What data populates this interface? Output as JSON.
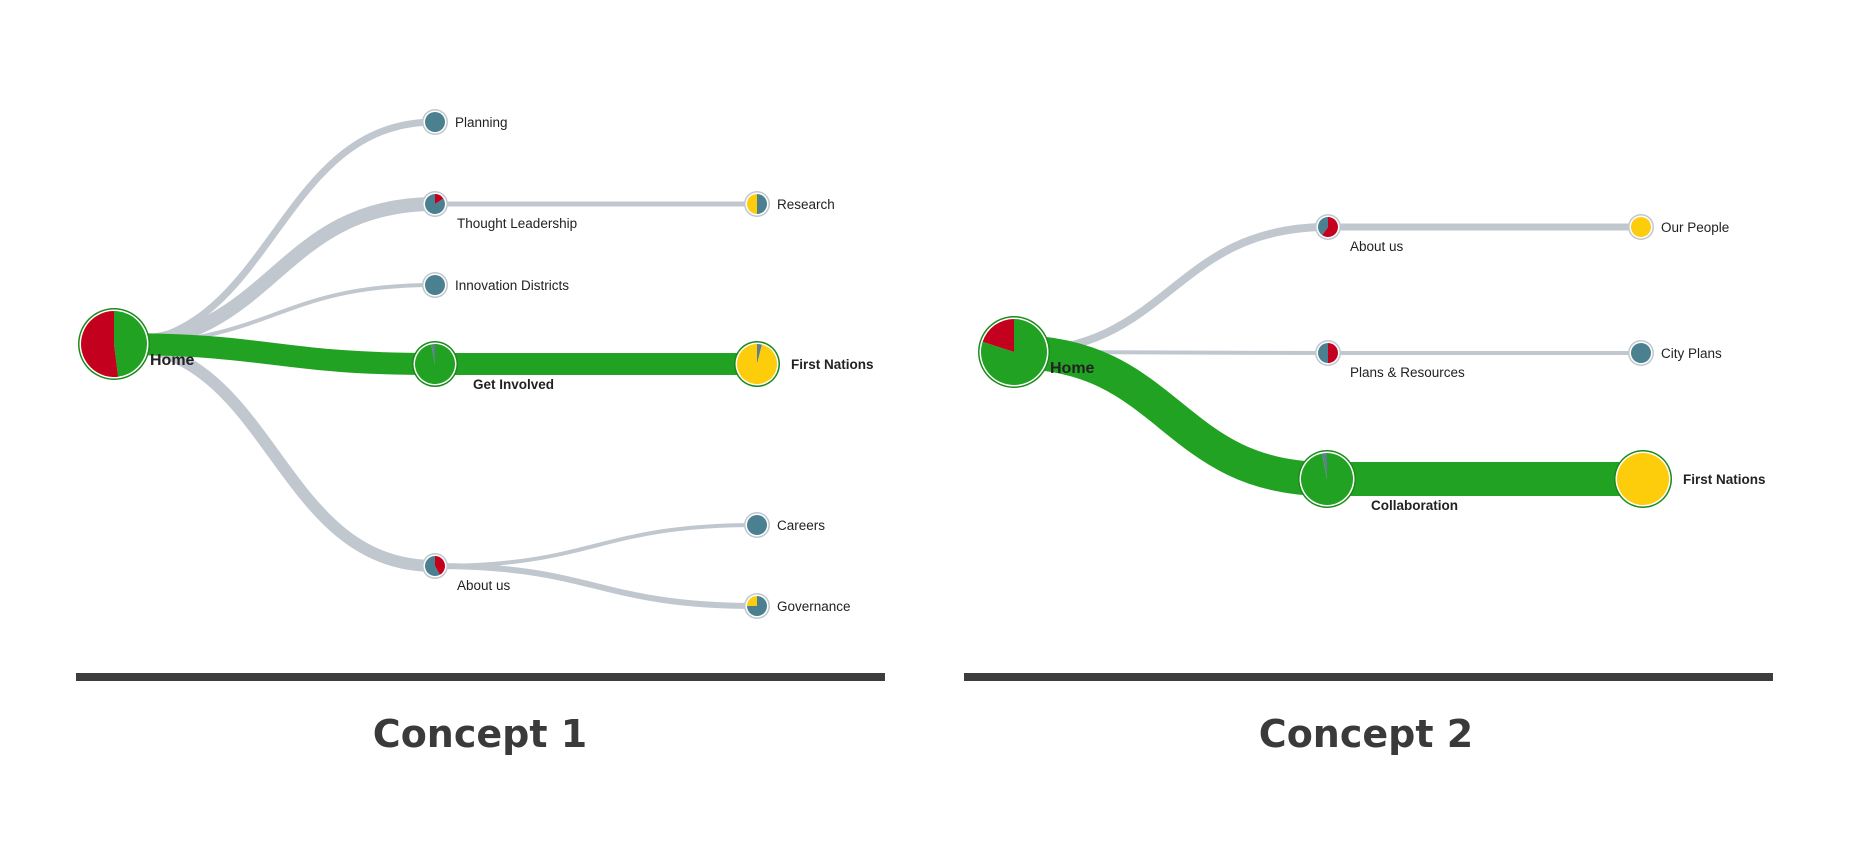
{
  "colors": {
    "green": "#22a222",
    "red": "#c4001f",
    "teal": "#4b8090",
    "yellow": "#fdcc0a",
    "slate": "#5f7f90",
    "link": "#c0c7cf",
    "ring_green": "#1a8a1a",
    "ring_gray": "#c0c7cf"
  },
  "concepts": [
    {
      "title": "Concept 1",
      "nodes": [
        {
          "id": "home",
          "label": "Home",
          "bold": true,
          "ring": "green",
          "size": "xl",
          "pie": [
            [
              "green",
              0.48
            ],
            [
              "red",
              0.52
            ]
          ]
        },
        {
          "id": "planning",
          "label": "Planning",
          "ring": "gray",
          "size": "s",
          "pie": [
            [
              "teal",
              1
            ]
          ]
        },
        {
          "id": "thought",
          "label": "Thought Leadership",
          "ring": "gray",
          "size": "s",
          "pie": [
            [
              "red",
              0.16
            ],
            [
              "teal",
              0.84
            ]
          ]
        },
        {
          "id": "research",
          "label": "Research",
          "ring": "gray",
          "size": "s",
          "pie": [
            [
              "teal",
              0.5
            ],
            [
              "yellow",
              0.5
            ]
          ]
        },
        {
          "id": "innovation",
          "label": "Innovation Districts",
          "ring": "gray",
          "size": "s",
          "pie": [
            [
              "teal",
              1
            ]
          ]
        },
        {
          "id": "getinvolved",
          "label": "Get Involved",
          "bold": true,
          "ring": "green",
          "size": "m",
          "pie": [
            [
              "green",
              0.97
            ],
            [
              "slate",
              0.03
            ]
          ]
        },
        {
          "id": "firstnations",
          "label": "First Nations",
          "bold": true,
          "ring": "green",
          "size": "m",
          "pie": [
            [
              "slate",
              0.04
            ],
            [
              "yellow",
              0.96
            ]
          ]
        },
        {
          "id": "about",
          "label": "About us",
          "ring": "gray",
          "size": "s",
          "pie": [
            [
              "red",
              0.42
            ],
            [
              "teal",
              0.58
            ]
          ]
        },
        {
          "id": "careers",
          "label": "Careers",
          "ring": "gray",
          "size": "s",
          "pie": [
            [
              "teal",
              1
            ]
          ]
        },
        {
          "id": "governance",
          "label": "Governance",
          "ring": "gray",
          "size": "s",
          "pie": [
            [
              "teal",
              0.75
            ],
            [
              "yellow",
              0.25
            ]
          ]
        }
      ],
      "links": [
        {
          "from": "home",
          "to": "planning",
          "weight": 7,
          "color": "link"
        },
        {
          "from": "home",
          "to": "thought",
          "weight": 14,
          "color": "link"
        },
        {
          "from": "home",
          "to": "innovation",
          "weight": 4,
          "color": "link"
        },
        {
          "from": "home",
          "to": "about",
          "weight": 12,
          "color": "link"
        },
        {
          "from": "home",
          "to": "getinvolved",
          "weight": 22,
          "color": "green"
        },
        {
          "from": "thought",
          "to": "research",
          "weight": 5,
          "color": "link"
        },
        {
          "from": "getinvolved",
          "to": "firstnations",
          "weight": 22,
          "color": "green"
        },
        {
          "from": "about",
          "to": "careers",
          "weight": 4,
          "color": "link"
        },
        {
          "from": "about",
          "to": "governance",
          "weight": 6,
          "color": "link"
        }
      ]
    },
    {
      "title": "Concept 2",
      "nodes": [
        {
          "id": "home",
          "label": "Home",
          "bold": true,
          "ring": "green",
          "size": "xl",
          "pie": [
            [
              "green",
              0.8
            ],
            [
              "red",
              0.2
            ]
          ]
        },
        {
          "id": "about",
          "label": "About us",
          "ring": "gray",
          "size": "s",
          "pie": [
            [
              "red",
              0.6
            ],
            [
              "teal",
              0.4
            ]
          ]
        },
        {
          "id": "ourpeople",
          "label": "Our People",
          "ring": "gray",
          "size": "s",
          "pie": [
            [
              "yellow",
              1
            ]
          ]
        },
        {
          "id": "plans",
          "label": "Plans & Resources",
          "ring": "gray",
          "size": "s",
          "pie": [
            [
              "red",
              0.5
            ],
            [
              "teal",
              0.5
            ]
          ]
        },
        {
          "id": "cityplans",
          "label": "City Plans",
          "ring": "gray",
          "size": "s",
          "pie": [
            [
              "teal",
              1
            ]
          ]
        },
        {
          "id": "collab",
          "label": "Collaboration",
          "bold": true,
          "ring": "green",
          "size": "l",
          "pie": [
            [
              "green",
              0.97
            ],
            [
              "slate",
              0.03
            ]
          ]
        },
        {
          "id": "firstnations",
          "label": "First Nations",
          "bold": true,
          "ring": "green",
          "size": "l",
          "pie": [
            [
              "yellow",
              1
            ]
          ]
        }
      ],
      "links": [
        {
          "from": "home",
          "to": "about",
          "weight": 8,
          "color": "link"
        },
        {
          "from": "home",
          "to": "plans",
          "weight": 4,
          "color": "link"
        },
        {
          "from": "home",
          "to": "collab",
          "weight": 34,
          "color": "green"
        },
        {
          "from": "about",
          "to": "ourpeople",
          "weight": 7,
          "color": "link"
        },
        {
          "from": "plans",
          "to": "cityplans",
          "weight": 4,
          "color": "link"
        },
        {
          "from": "collab",
          "to": "firstnations",
          "weight": 34,
          "color": "green"
        }
      ]
    }
  ]
}
